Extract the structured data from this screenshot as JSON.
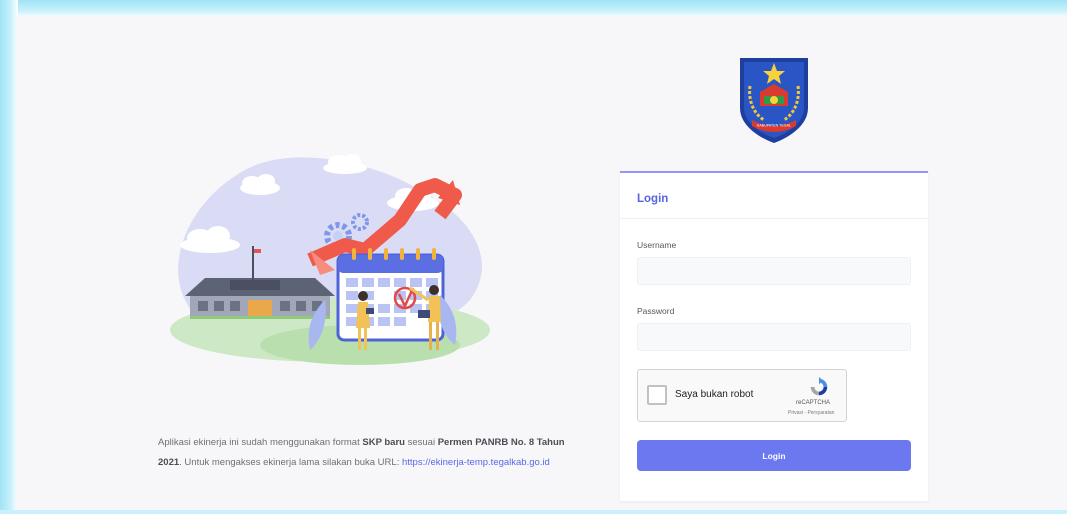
{
  "info": {
    "part1": "Aplikasi ekinerja ini sudah menggunakan format ",
    "bold1": "SKP baru",
    "part2": " sesuai ",
    "bold2": "Permen PANRB No. 8 Tahun 2021",
    "part3": ". Untuk mengakses ekinerja lama silakan buka URL: ",
    "link": "https://ekinerja-temp.tegalkab.go.id"
  },
  "emblem": {
    "banner_text": "KABUPATEN TEGAL"
  },
  "login": {
    "title": "Login",
    "username_label": "Username",
    "username_value": "",
    "password_label": "Password",
    "password_value": "",
    "captcha_text": "Saya bukan robot",
    "captcha_brand": "reCAPTCHA",
    "captcha_links": "Privasi - Persyaratan",
    "button_label": "Login"
  },
  "colors": {
    "accent": "#6c78ef",
    "title": "#5664e4",
    "link": "#5a67e8",
    "frame_glow": "#9fe3f5"
  },
  "icons": [
    "emblem-logo",
    "recaptcha-icon",
    "checkbox-icon"
  ]
}
